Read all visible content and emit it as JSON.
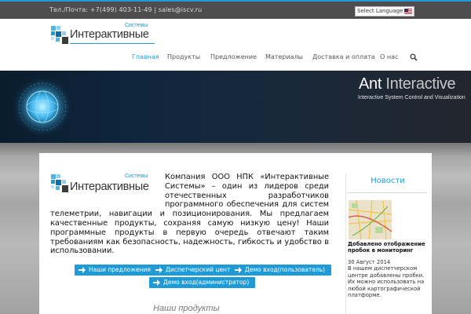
{
  "topbar": {
    "contacts": "Тел./Почта: +7(499) 403-11-49 | sales@iscv.ru",
    "language_select": "Select Language"
  },
  "logo": {
    "systems_label": "Системы",
    "brand_text": "Интерактивные"
  },
  "nav": {
    "items": [
      {
        "label": "Главная"
      },
      {
        "label": "Продукты"
      },
      {
        "label": "Предложение"
      },
      {
        "label": "Материалы"
      },
      {
        "label": "Доставка и оплата"
      },
      {
        "label": "О нас"
      }
    ]
  },
  "banner": {
    "title_part1": "Ant",
    "title_part2": "Interactive",
    "subtitle": "Interactive System Control and Visualization"
  },
  "main": {
    "intro": "Компания ООО НПК «Интерактивные Системы» – один из лидеров среди отечественных разработчиков программного обеспечения для систем телеметрии, навигации и позиционирования. Мы предлагаем качественные продукты, сохраняя самую низкую цену! Наши программные продукты в первую очередь отвечают таким требованиям как безопасность, надежность, гибкость и удобство в использовании.",
    "buttons": [
      {
        "label": "Наши предложения"
      },
      {
        "label": "Диспетчерский центр"
      },
      {
        "label": "Демо вход(пользователь)"
      },
      {
        "label": "Демо вход(администратор)"
      }
    ],
    "products_heading": "Наши продукты"
  },
  "news": {
    "title": "Новости",
    "item": {
      "headline": "Добавлено отображение пробок в мониторинг",
      "date": "30 Август 2014",
      "body": "В нашем диспетчерском центре добавлены пробки. Их можно использовать на любой картографической платформе."
    }
  },
  "colors": {
    "accent": "#1e9bd7",
    "topbar": "#4d4d4d",
    "banner": "#10263d"
  }
}
